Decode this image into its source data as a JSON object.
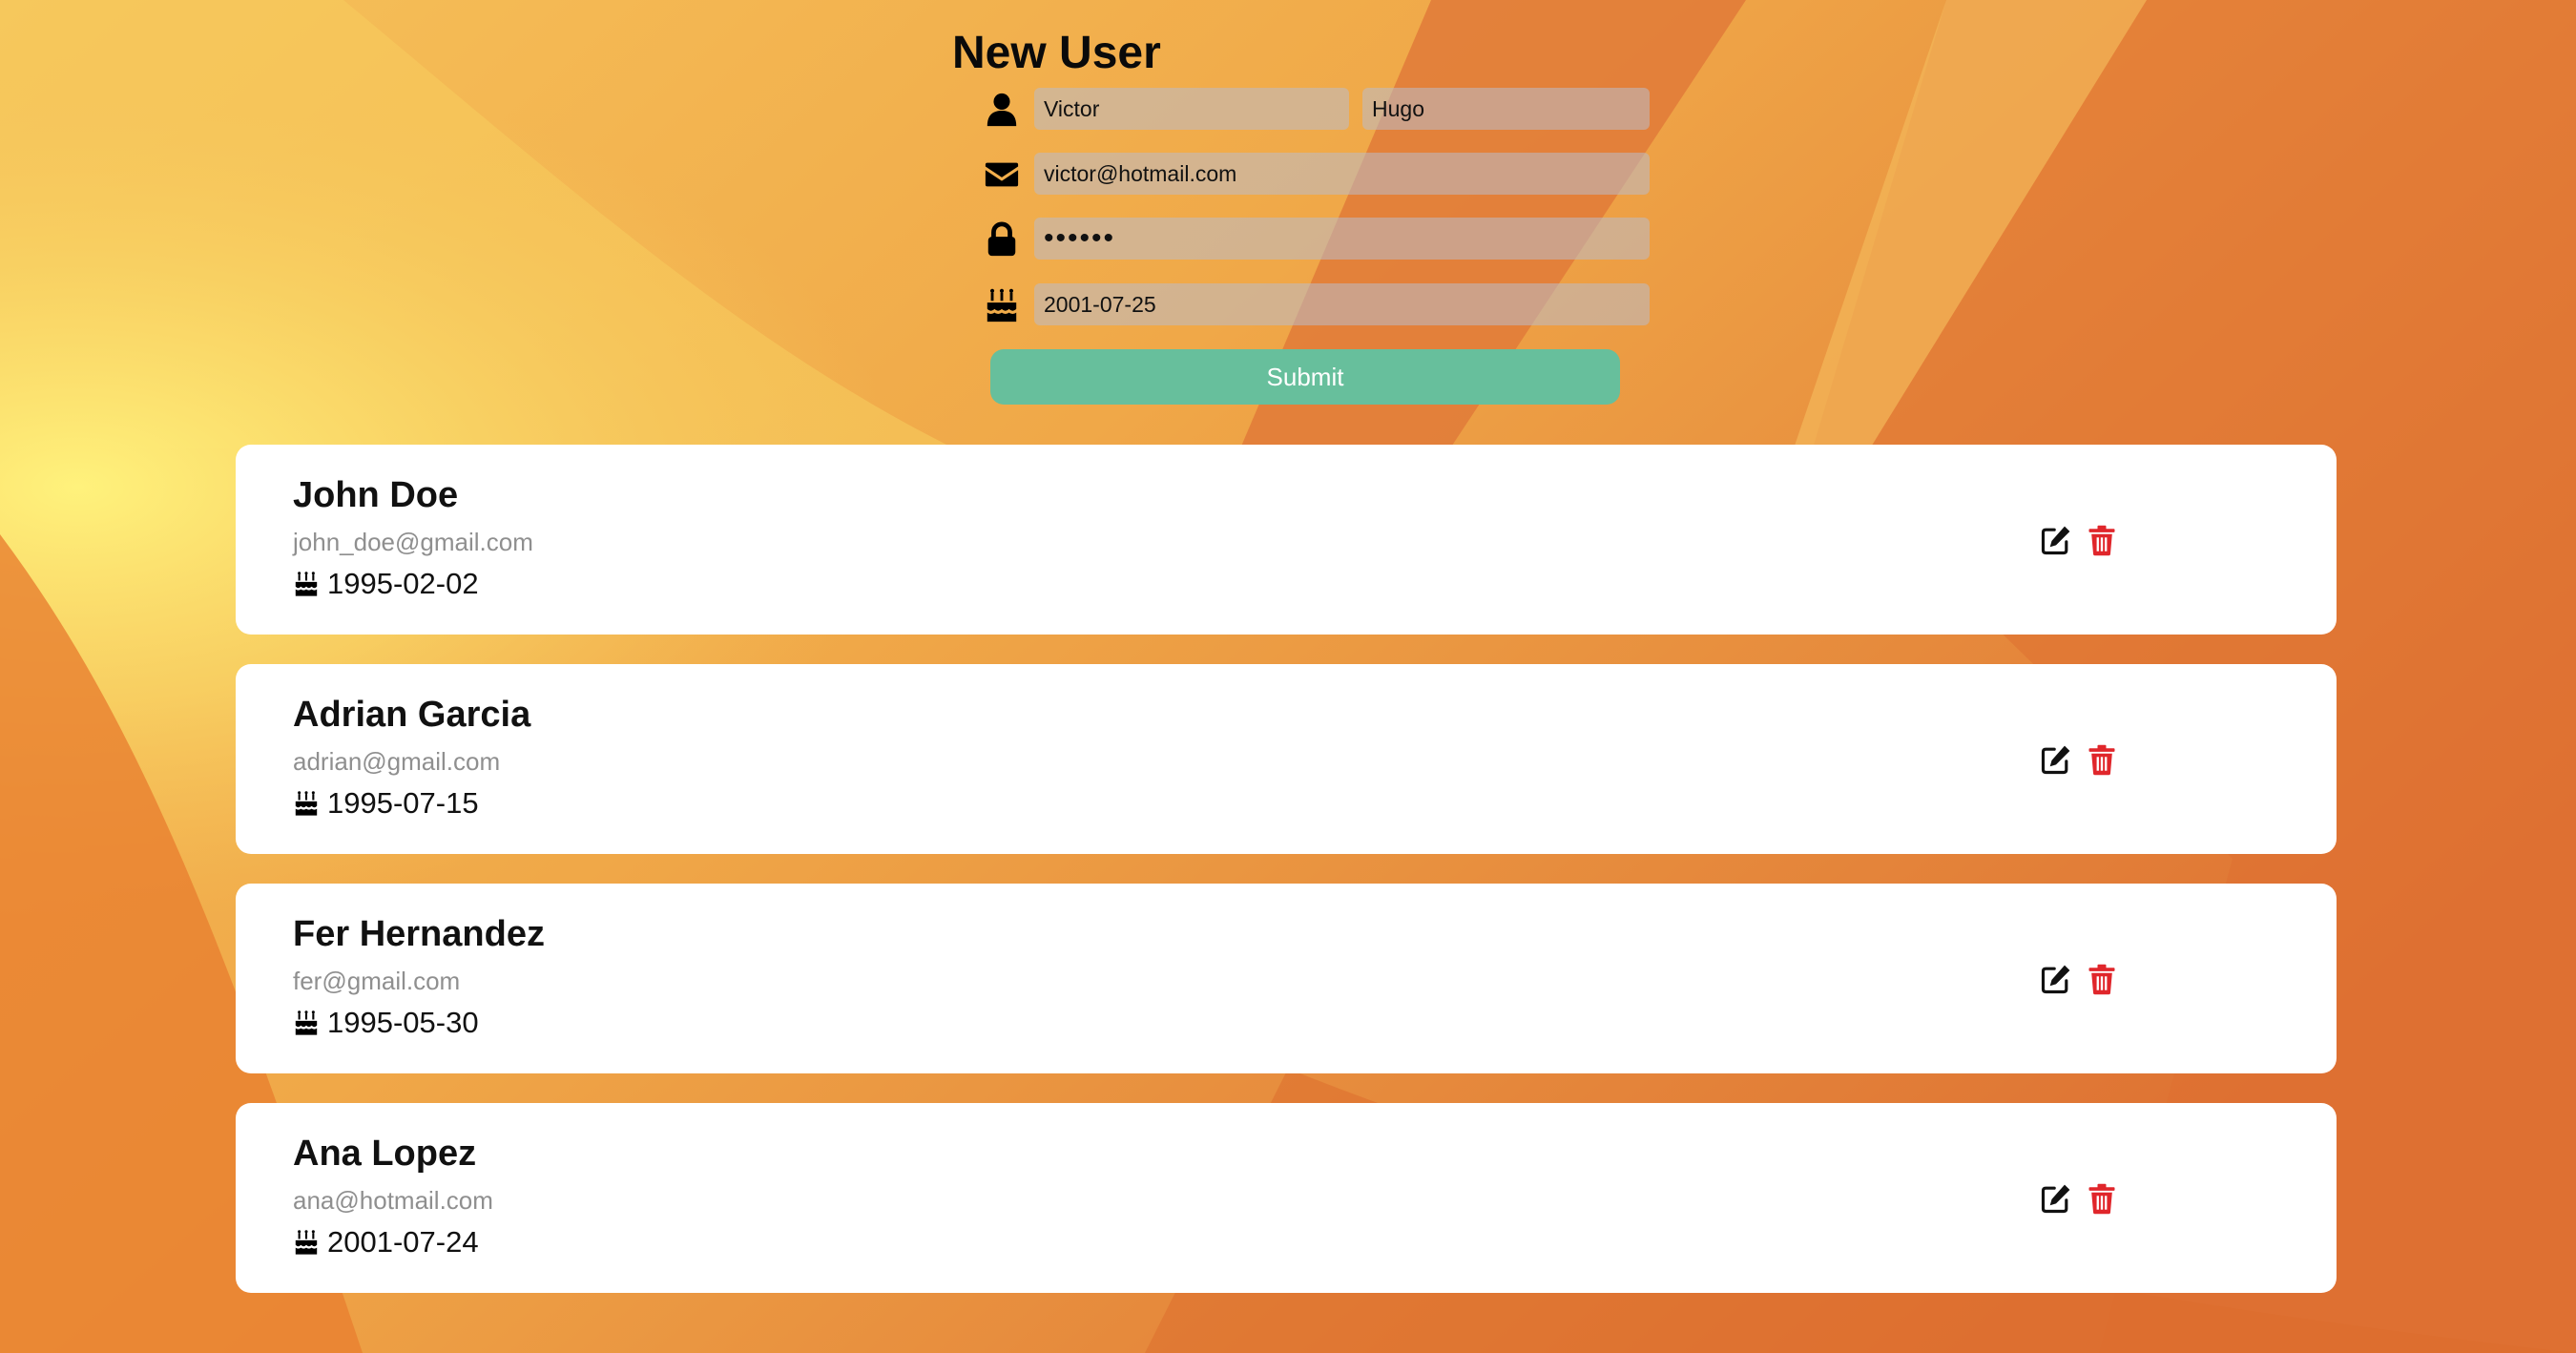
{
  "form": {
    "title": "New User",
    "first_name": "Victor",
    "last_name": "Hugo",
    "email": "victor@hotmail.com",
    "password": "••••••",
    "birthdate": "2001-07-25",
    "submit_label": "Submit"
  },
  "users": [
    {
      "name": "John Doe",
      "email": "john_doe@gmail.com",
      "birthday": "1995-02-02"
    },
    {
      "name": "Adrian Garcia",
      "email": "adrian@gmail.com",
      "birthday": "1995-07-15"
    },
    {
      "name": "Fer Hernandez",
      "email": "fer@gmail.com",
      "birthday": "1995-05-30"
    },
    {
      "name": "Ana Lopez",
      "email": "ana@hotmail.com",
      "birthday": "2001-07-24"
    }
  ],
  "icons": {
    "name_row": "user-icon",
    "email_row": "envelope-icon",
    "password_row": "lock-icon",
    "birthday_row": "birthday-cake-icon",
    "card_birthday": "birthday-cake-icon",
    "edit": "edit-icon",
    "delete": "trash-icon"
  },
  "colors": {
    "submit": "#67bf9c",
    "delete": "#e0262b",
    "card": "#ffffff",
    "email_text": "#8f8f8f"
  }
}
